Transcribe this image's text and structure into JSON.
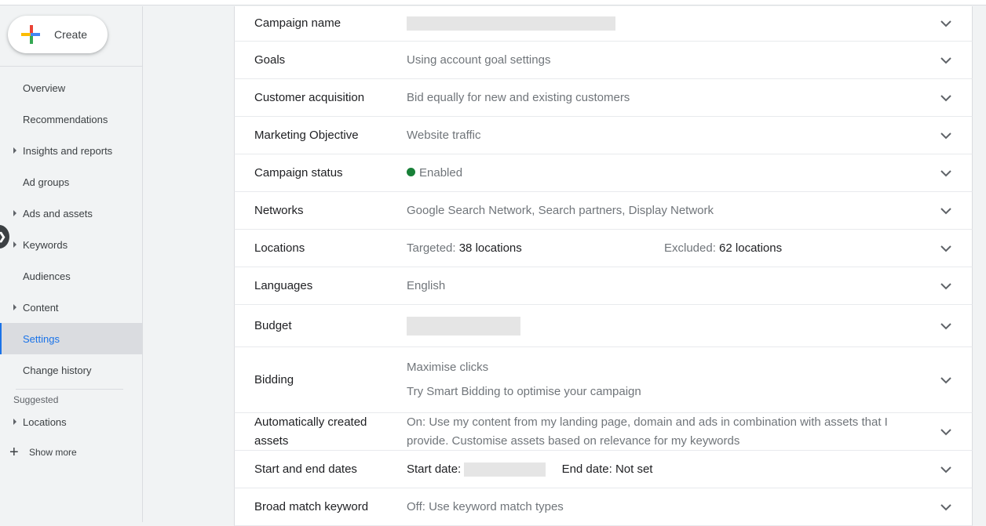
{
  "sidebar": {
    "create_label": "Create",
    "items": [
      {
        "label": "Overview",
        "expandable": false,
        "active": false
      },
      {
        "label": "Recommendations",
        "expandable": false,
        "active": false
      },
      {
        "label": "Insights and reports",
        "expandable": true,
        "active": false
      },
      {
        "label": "Ad groups",
        "expandable": false,
        "active": false
      },
      {
        "label": "Ads and assets",
        "expandable": true,
        "active": false
      },
      {
        "label": "Keywords",
        "expandable": true,
        "active": false
      },
      {
        "label": "Audiences",
        "expandable": false,
        "active": false
      },
      {
        "label": "Content",
        "expandable": true,
        "active": false
      },
      {
        "label": "Settings",
        "expandable": false,
        "active": true
      },
      {
        "label": "Change history",
        "expandable": false,
        "active": false
      }
    ],
    "suggested_label": "Suggested",
    "suggested_items": [
      {
        "label": "Locations",
        "expandable": true
      }
    ],
    "show_more_label": "Show more",
    "collapse_icon": "chevron-right-icon"
  },
  "settings": {
    "campaign_name": {
      "label": "Campaign name",
      "value": "[redacted]"
    },
    "goals": {
      "label": "Goals",
      "value": "Using account goal settings"
    },
    "customer_acquisition": {
      "label": "Customer acquisition",
      "value": "Bid equally for new and existing customers"
    },
    "marketing_objective": {
      "label": "Marketing Objective",
      "value": "Website traffic"
    },
    "campaign_status": {
      "label": "Campaign status",
      "value": "Enabled",
      "status_color": "#188038"
    },
    "networks": {
      "label": "Networks",
      "value": "Google Search Network, Search partners, Display Network"
    },
    "locations": {
      "label": "Locations",
      "targeted_label": "Targeted:",
      "targeted_value": "38 locations",
      "excluded_label": "Excluded:",
      "excluded_value": "62 locations"
    },
    "languages": {
      "label": "Languages",
      "value": "English"
    },
    "budget": {
      "label": "Budget",
      "value": "[redacted]"
    },
    "bidding": {
      "label": "Bidding",
      "value": "Maximise clicks",
      "link": "Try Smart Bidding to optimise your campaign"
    },
    "auto_assets": {
      "label": "Automatically created assets",
      "value": "On: Use my content from my landing page, domain and ads in combination with assets that I provide. Customise assets based on relevance for my keywords"
    },
    "dates": {
      "label": "Start and end dates",
      "start_label": "Start date:",
      "start_value": "[redacted]",
      "end_text": "End date: Not set"
    },
    "broad_match": {
      "label": "Broad match keyword",
      "value": "Off: Use keyword match types"
    }
  },
  "colors": {
    "accent": "#1a73e8",
    "status_enabled": "#188038"
  }
}
